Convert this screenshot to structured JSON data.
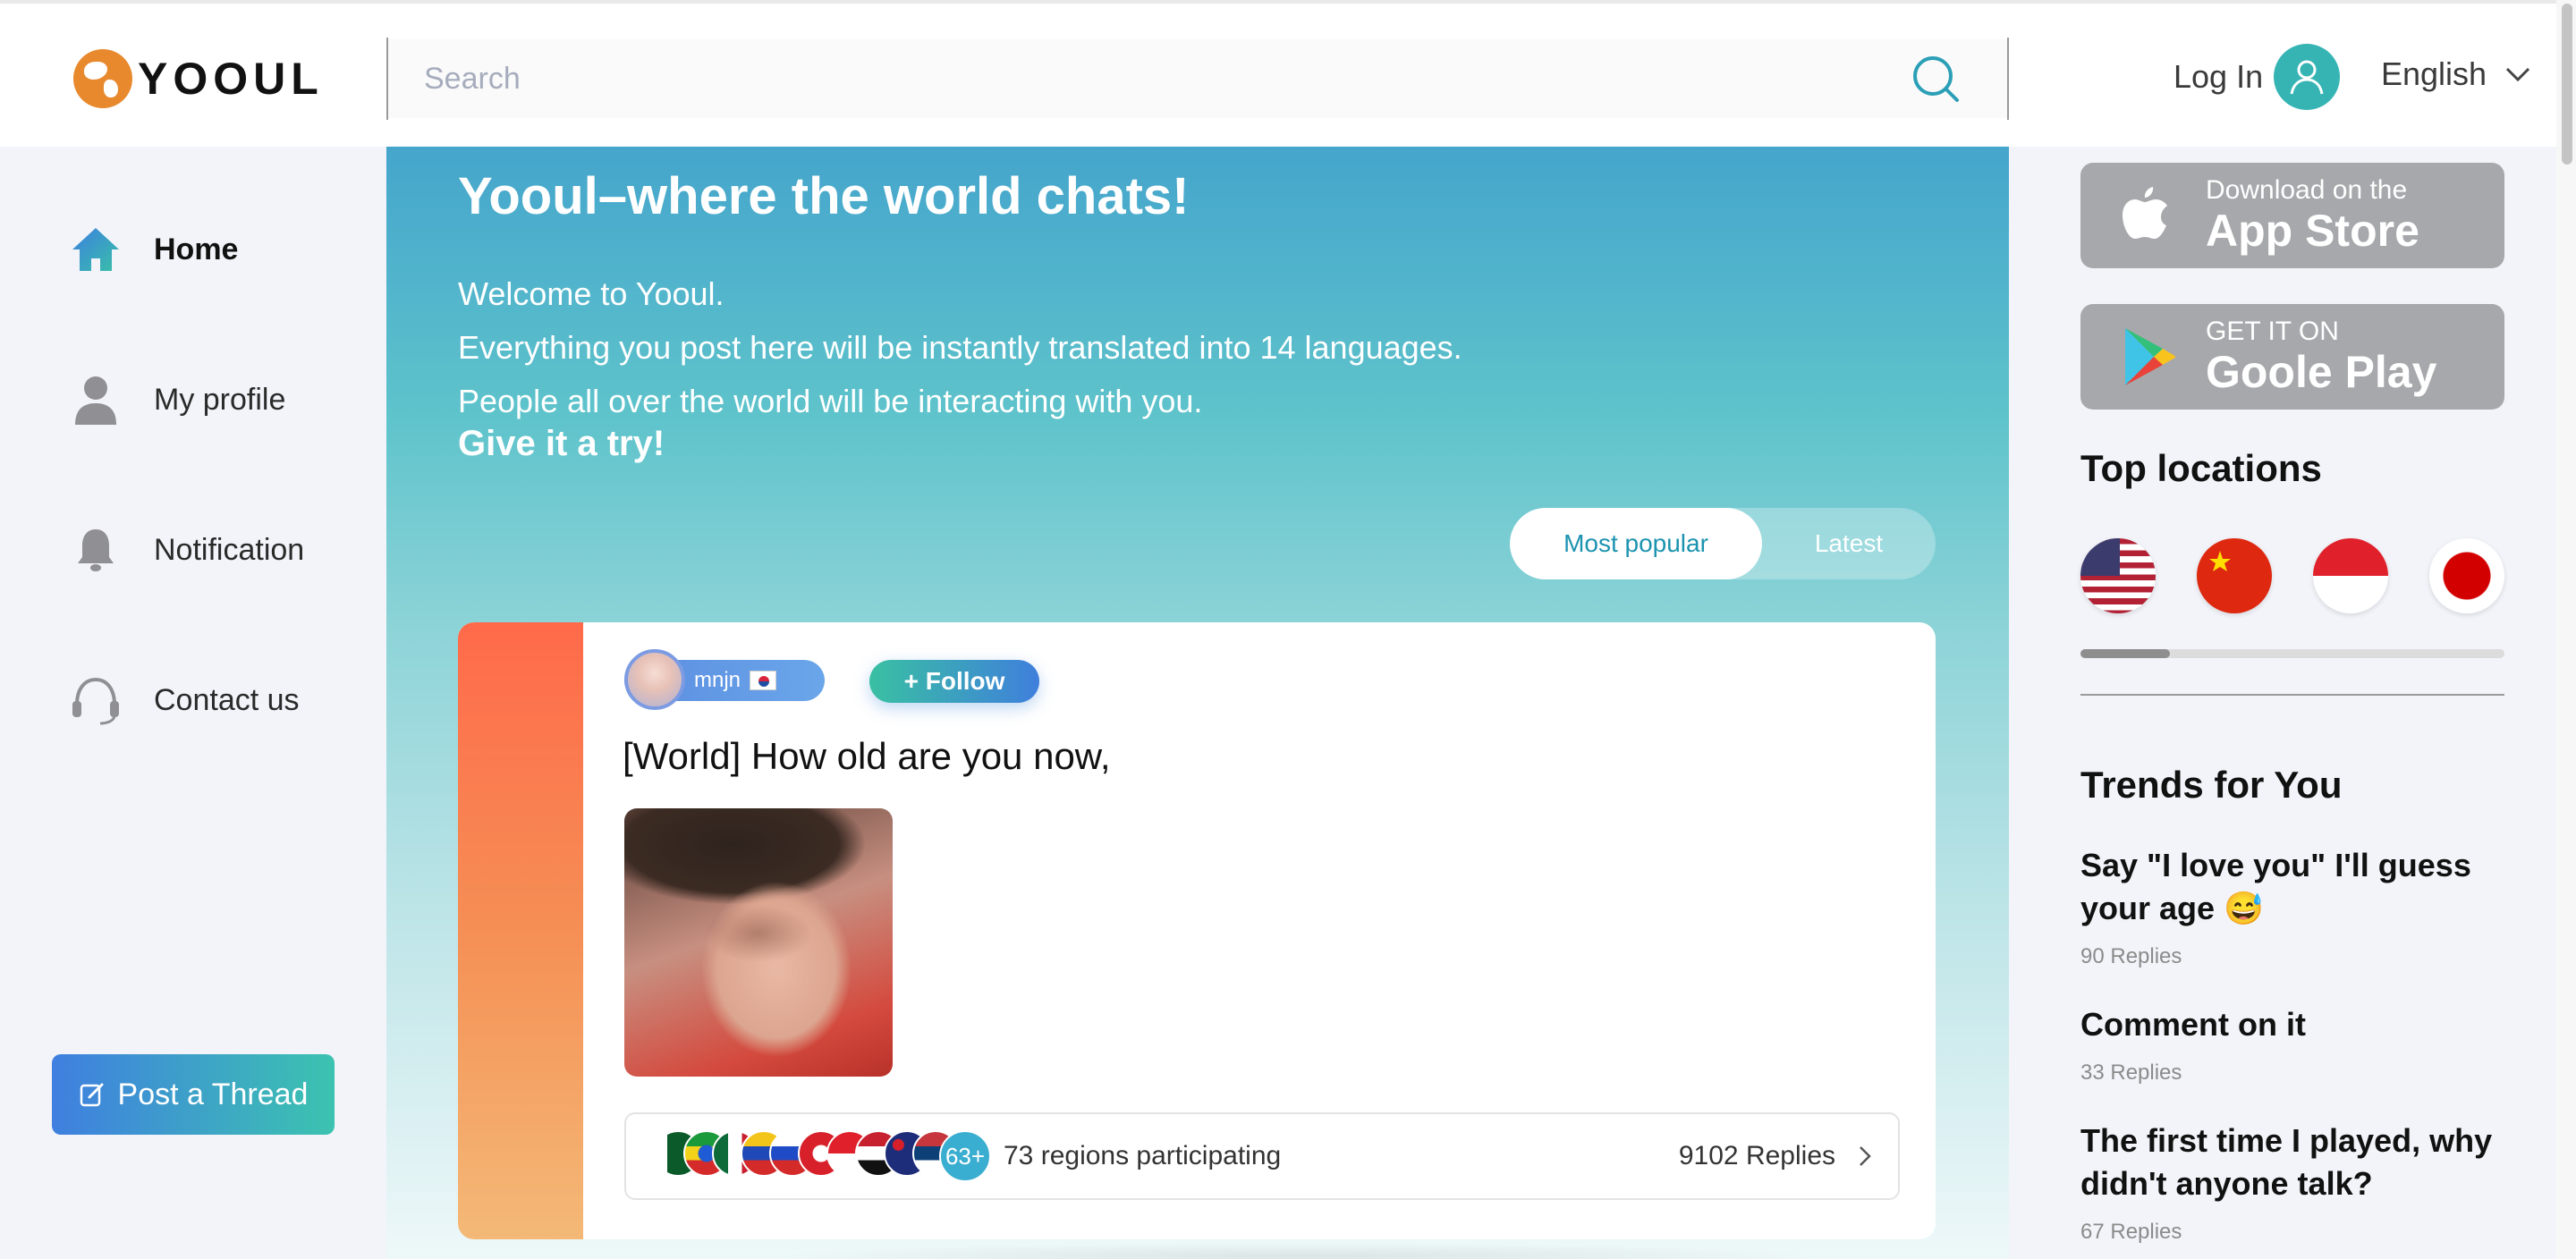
{
  "header": {
    "logo_text": "YOOUL",
    "search_placeholder": "Search",
    "login_label": "Log In",
    "language": "English"
  },
  "sidebar": {
    "items": [
      {
        "label": "Home",
        "icon": "home-icon",
        "active": true
      },
      {
        "label": "My profile",
        "icon": "user-icon"
      },
      {
        "label": "Notification",
        "icon": "bell-icon"
      },
      {
        "label": "Contact us",
        "icon": "headset-icon"
      }
    ],
    "post_button": "Post a Thread"
  },
  "banner": {
    "title": "Yooul–where the world chats!",
    "line1": "Welcome to Yooul.",
    "line2": "Everything you post here will be instantly translated into 14 languages.",
    "line3": "People all over the world will be interacting with you.",
    "cta": "Give it a try!"
  },
  "sort_tabs": {
    "most_popular": "Most popular",
    "latest": "Latest",
    "active": "Most popular"
  },
  "thread": {
    "author": "mnjn",
    "author_country_flag": "KR",
    "follow_label": "+ Follow",
    "title": "[World] How old are you now,",
    "regions_count_badge": "63+",
    "regions_text": "73 regions participating",
    "replies_text": "9102 Replies",
    "participant_flags": [
      "Pakistan",
      "Ethiopia",
      "Mexico",
      "Venezuela",
      "Russia",
      "Hong Kong",
      "Indonesia",
      "Iraq",
      "Australia",
      "Serbia"
    ]
  },
  "right": {
    "app_store": {
      "small": "Download on the",
      "big": "App Store"
    },
    "google_play": {
      "small": "GET IT ON",
      "big": "Goole Play"
    },
    "top_locations_title": "Top locations",
    "top_locations": [
      "United States",
      "China",
      "Indonesia",
      "Japan"
    ],
    "top_locations_scroll_fraction": 0.21,
    "trends_title": "Trends for You",
    "trends": [
      {
        "title": "Say \"I love you\" I'll guess your age 😅",
        "meta": "90 Replies"
      },
      {
        "title": "Comment on it",
        "meta": "33 Replies"
      },
      {
        "title": "The first time I played, why didn't anyone talk?",
        "meta": "67 Replies"
      }
    ]
  },
  "colors": {
    "accent_teal": "#36b4b4",
    "brand_orange": "#e8892e",
    "follow_gradient_start": "#39c0a2",
    "follow_gradient_end": "#3f7fdc",
    "link_blue": "#1c93b0"
  }
}
